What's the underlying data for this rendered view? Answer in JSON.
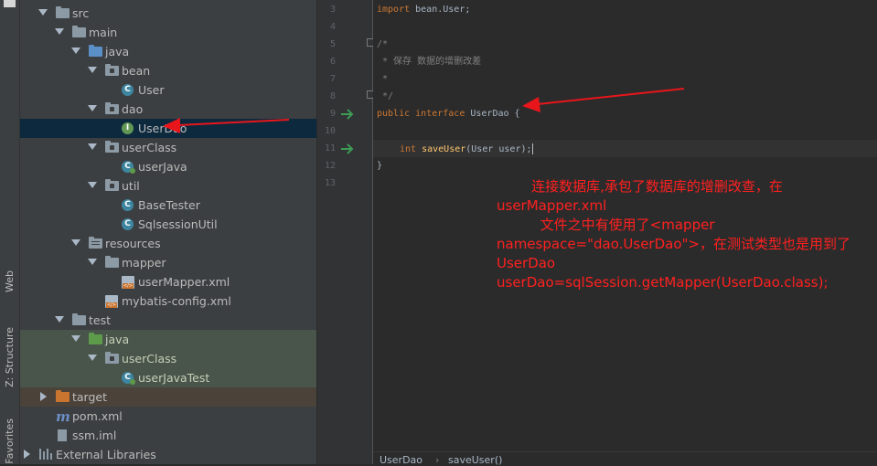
{
  "side_tabs": {
    "web": "Web",
    "structure": "Z: Structure",
    "favorites": "Favorites"
  },
  "tree": {
    "src": "src",
    "main": "main",
    "java": "java",
    "bean": "bean",
    "user": "User",
    "dao": "dao",
    "userdao": "UserDao",
    "userclass": "userClass",
    "userjava": "userJava",
    "util": "util",
    "basetester": "BaseTester",
    "sqlsessionutil": "SqlsessionUtil",
    "resources": "resources",
    "mapper": "mapper",
    "usermapper": "userMapper.xml",
    "mybatis": "mybatis-config.xml",
    "test": "test",
    "test_java": "java",
    "test_userclass": "userClass",
    "userjavatest": "userJavaTest",
    "target": "target",
    "pom": "pom.xml",
    "ssm": "ssm.iml",
    "libs": "External Libraries"
  },
  "line_numbers": [
    "3",
    "4",
    "5",
    "6",
    "7",
    "8",
    "9",
    "10",
    "11",
    "12",
    "13"
  ],
  "code": {
    "l3_kw": "import",
    "l3_rest": " bean.User;",
    "l5": "/*",
    "l6": " * 保存 数据的增删改差",
    "l7": " *",
    "l8": " */",
    "l9_kw1": "public",
    "l9_kw2": "interface",
    "l9_rest": " UserDao {",
    "l11_kw": "int",
    "l11_fn": "saveUser",
    "l11_rest": "(User user);",
    "l12": "}"
  },
  "annotation": {
    "line1": "        连接数据库,承包了数据库的增删改查，在",
    "line2": "userMapper.xml",
    "line3": "          文件之中有使用了<mapper",
    "line4": "namespace=\"dao.UserDao\">，在测试类型也是用到了",
    "line5": "UserDao",
    "line6": "userDao=sqlSession.getMapper(UserDao.class);"
  },
  "breadcrumb": {
    "item1": "UserDao",
    "item2": "saveUser()"
  },
  "colors": {
    "annotation_arrow": "#e8161b",
    "keyword": "#cc7832",
    "comment": "#808080",
    "method": "#ffc66d",
    "implementation_marker": "#3e9c55"
  }
}
